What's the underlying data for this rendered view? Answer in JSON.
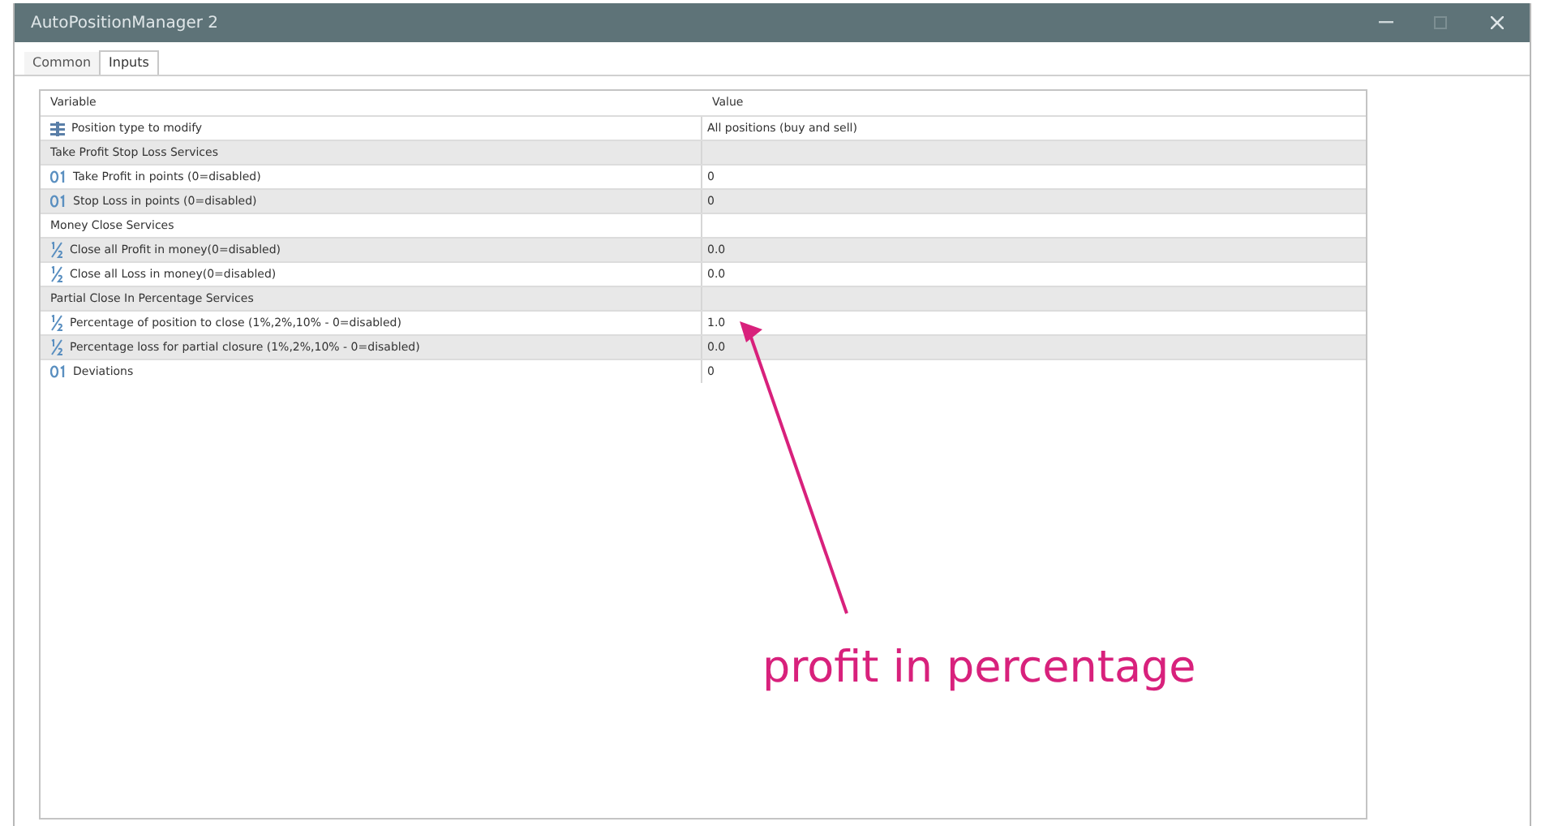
{
  "window": {
    "title": "AutoPositionManager 2"
  },
  "tabs": [
    {
      "label": "Common",
      "selected": false
    },
    {
      "label": "Inputs",
      "selected": true
    }
  ],
  "table": {
    "columns": [
      "Variable",
      "Value"
    ],
    "rows": [
      {
        "kind": "enum",
        "variable": "Position type to modify",
        "value": "All positions (buy and sell)"
      },
      {
        "kind": "section",
        "variable": "Take Profit Stop Loss Services"
      },
      {
        "kind": "int",
        "variable": "Take Profit in points (0=disabled)",
        "value": "0"
      },
      {
        "kind": "int",
        "variable": "Stop Loss in points (0=disabled)",
        "value": "0"
      },
      {
        "kind": "section",
        "variable": "Money Close Services"
      },
      {
        "kind": "double",
        "variable": "Close all Profit in money(0=disabled)",
        "value": "0.0"
      },
      {
        "kind": "double",
        "variable": "Close all Loss in money(0=disabled)",
        "value": "0.0"
      },
      {
        "kind": "section",
        "variable": "Partial Close In Percentage Services"
      },
      {
        "kind": "double",
        "variable": "Percentage of position to close (1%,2%,10% - 0=disabled)",
        "value": "1.0"
      },
      {
        "kind": "double",
        "variable": "Percentage loss for partial closure (1%,2%,10% - 0=disabled)",
        "value": "0.0"
      },
      {
        "kind": "int",
        "variable": "Deviations",
        "value": "0"
      }
    ]
  },
  "annotation": {
    "text": "profit in percentage"
  }
}
